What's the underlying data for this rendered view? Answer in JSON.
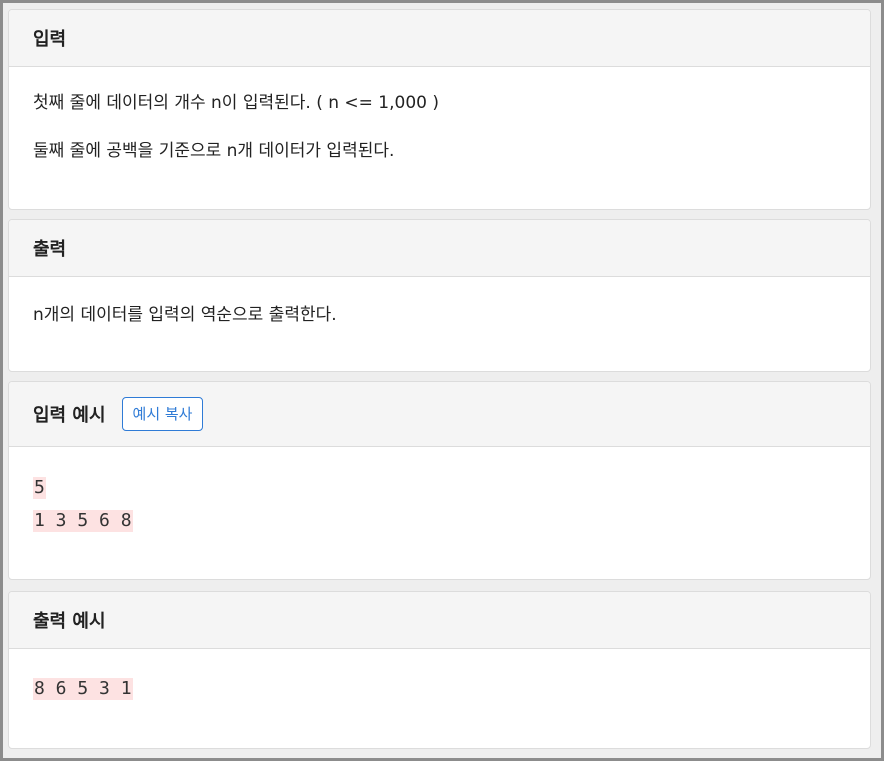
{
  "input_section": {
    "title": "입력",
    "lines": [
      "첫째 줄에 데이터의 개수 n이 입력된다. ( n <= 1,000 )",
      "둘째 줄에 공백을 기준으로 n개 데이터가 입력된다."
    ]
  },
  "output_section": {
    "title": "출력",
    "lines": [
      "n개의 데이터를 입력의 역순으로 출력한다."
    ]
  },
  "sample_input": {
    "title": "입력 예시",
    "copy_button": "예시 복사",
    "lines": [
      "5",
      "1 3 5 6 8"
    ]
  },
  "sample_output": {
    "title": "출력 예시",
    "lines": [
      "8 6 5 3 1"
    ]
  }
}
